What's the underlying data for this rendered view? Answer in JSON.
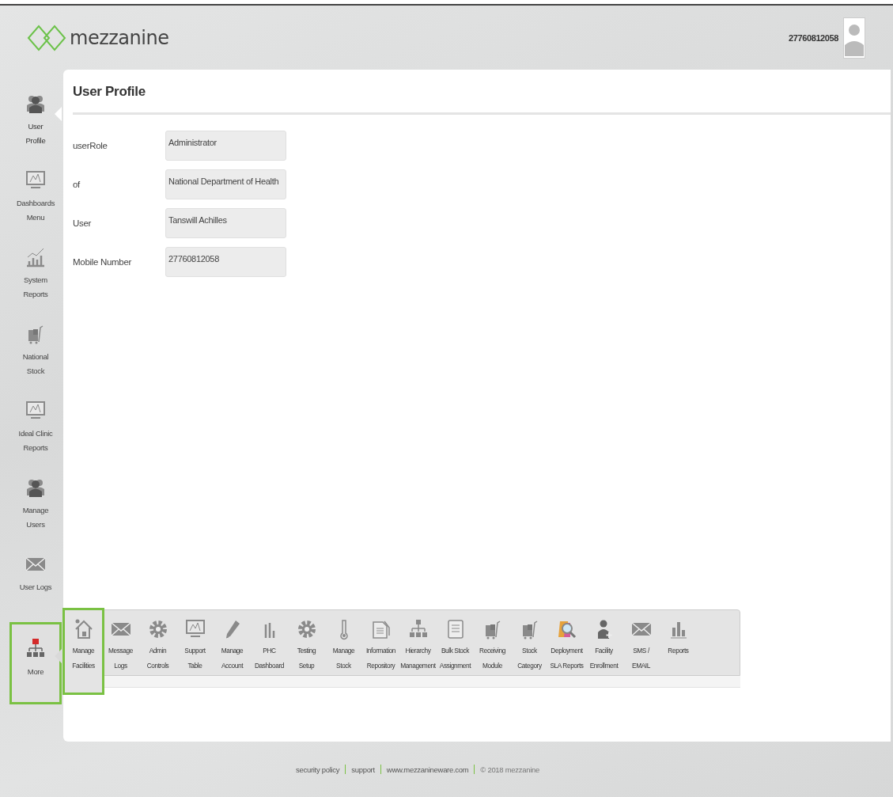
{
  "header": {
    "logo": "mezzanine",
    "user_number": "27760812058"
  },
  "sidebar": {
    "items": [
      {
        "label": "User\nProfile",
        "selected": true,
        "expanded": false,
        "highlighted": false
      },
      {
        "label": "Dashboards\nMenu",
        "selected": false,
        "expanded": false,
        "highlighted": false
      },
      {
        "label": "System\nReports",
        "selected": false,
        "expanded": false,
        "highlighted": false
      },
      {
        "label": "National\nStock",
        "selected": false,
        "expanded": false,
        "highlighted": false
      },
      {
        "label": "Ideal Clinic\nReports",
        "selected": false,
        "expanded": false,
        "highlighted": false
      },
      {
        "label": "Manage\nUsers",
        "selected": false,
        "expanded": false,
        "highlighted": false
      },
      {
        "label": "User Logs",
        "selected": false,
        "expanded": false,
        "highlighted": false
      },
      {
        "label": "More",
        "selected": false,
        "expanded": true,
        "highlighted": true
      }
    ]
  },
  "panel": {
    "title": "User Profile",
    "fields": [
      {
        "label": "userRole",
        "value": "Administrator"
      },
      {
        "label": "of",
        "value": "National Department of Health"
      },
      {
        "label": "User",
        "value": "Tanswill Achilles"
      },
      {
        "label": "Mobile Number",
        "value": "27760812058"
      }
    ]
  },
  "more_menu": {
    "items": [
      {
        "label": "Manage\nFacilities",
        "highlighted": true
      },
      {
        "label": "Message\nLogs",
        "highlighted": false
      },
      {
        "label": "Admin\nControls",
        "highlighted": false
      },
      {
        "label": "Support\nTable",
        "highlighted": false
      },
      {
        "label": "Manage\nAccount",
        "highlighted": false
      },
      {
        "label": "PHC\nDashboard",
        "highlighted": false
      },
      {
        "label": "Testing\nSetup",
        "highlighted": false
      },
      {
        "label": "Manage\nStock",
        "highlighted": false
      },
      {
        "label": "Information\nRepository",
        "highlighted": false
      },
      {
        "label": "Hierarchy\nManagement",
        "highlighted": false
      },
      {
        "label": "Bulk Stock\nAssignment",
        "highlighted": false
      },
      {
        "label": "Receiving\nModule",
        "highlighted": false
      },
      {
        "label": "Stock\nCategory",
        "highlighted": false
      },
      {
        "label": "Deployment\nSLA Reports",
        "highlighted": false
      },
      {
        "label": "Facility\nEnrollment",
        "highlighted": false
      },
      {
        "label": "SMS /\nEMAIL",
        "highlighted": false
      },
      {
        "label": "Reports",
        "highlighted": false
      }
    ]
  },
  "footer": {
    "links": [
      "security policy",
      "support",
      "www.mezzanineware.com"
    ],
    "copyright": "© 2018 mezzanine"
  }
}
